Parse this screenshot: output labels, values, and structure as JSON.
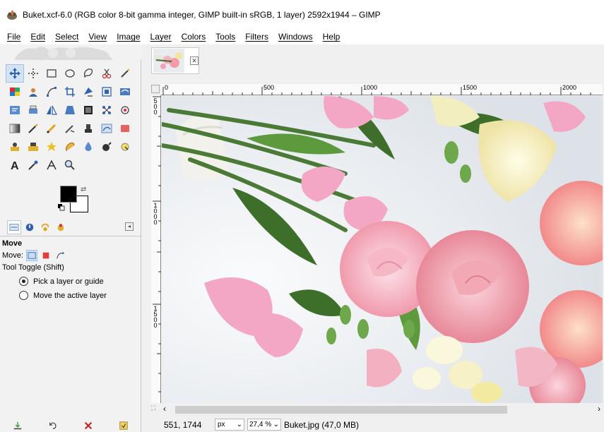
{
  "window": {
    "title": "Buket.xcf-6.0 (RGB color 8-bit gamma integer, GIMP built-in sRGB, 1 layer) 2592x1944 – GIMP"
  },
  "menubar": {
    "items": [
      "File",
      "Edit",
      "Select",
      "View",
      "Image",
      "Layer",
      "Colors",
      "Tools",
      "Filters",
      "Windows",
      "Help"
    ]
  },
  "toolbox": {
    "tools": [
      "move-tool-icon",
      "alignment-tool-icon",
      "rectangle-select-icon",
      "ellipse-select-icon",
      "free-select-icon",
      "scissors-select-icon",
      "fuzzy-select-icon",
      "by-color-select-icon",
      "foreground-select-icon",
      "paths-tool-icon",
      "crop-tool-icon",
      "transform-tool-icon",
      "cage-transform-icon",
      "warp-transform-icon",
      "text-box-icon",
      "print-icon",
      "flip-tool-icon",
      "perspective-tool-icon",
      "scale-tool-icon",
      "unified-transform-icon",
      "handle-transform-icon",
      "gradient-tool-icon",
      "paintbrush-icon",
      "pencil-icon",
      "airbrush-icon",
      "ink-tool-icon",
      "mypaint-brush-icon",
      "eraser-icon",
      "clone-tool-icon",
      "heal-tool-icon",
      "perspective-clone-icon",
      "smudge-tool-icon",
      "blur-tool-icon",
      "dodge-burn-icon",
      "dodge-icon",
      "text-tool-icon",
      "color-picker-icon",
      "measure-tool-icon",
      "zoom-tool-icon"
    ],
    "colors": {
      "foreground": "#000000",
      "background": "#ffffff"
    }
  },
  "tool_options": {
    "title": "Move",
    "move_label": "Move:",
    "toggle_label": "Tool Toggle  (Shift)",
    "radio_pick": "Pick a layer or guide",
    "radio_move": "Move the active layer"
  },
  "image_window": {
    "ruler_h_labels": [
      "0",
      "500",
      "1000",
      "1500",
      "2000"
    ],
    "ruler_v_labels": [
      "500",
      "1000",
      "1500"
    ]
  },
  "statusbar": {
    "coords": "551, 1744",
    "unit": "px",
    "zoom": "27,4 %",
    "message": "Buket.jpg (47,0 MB)"
  }
}
